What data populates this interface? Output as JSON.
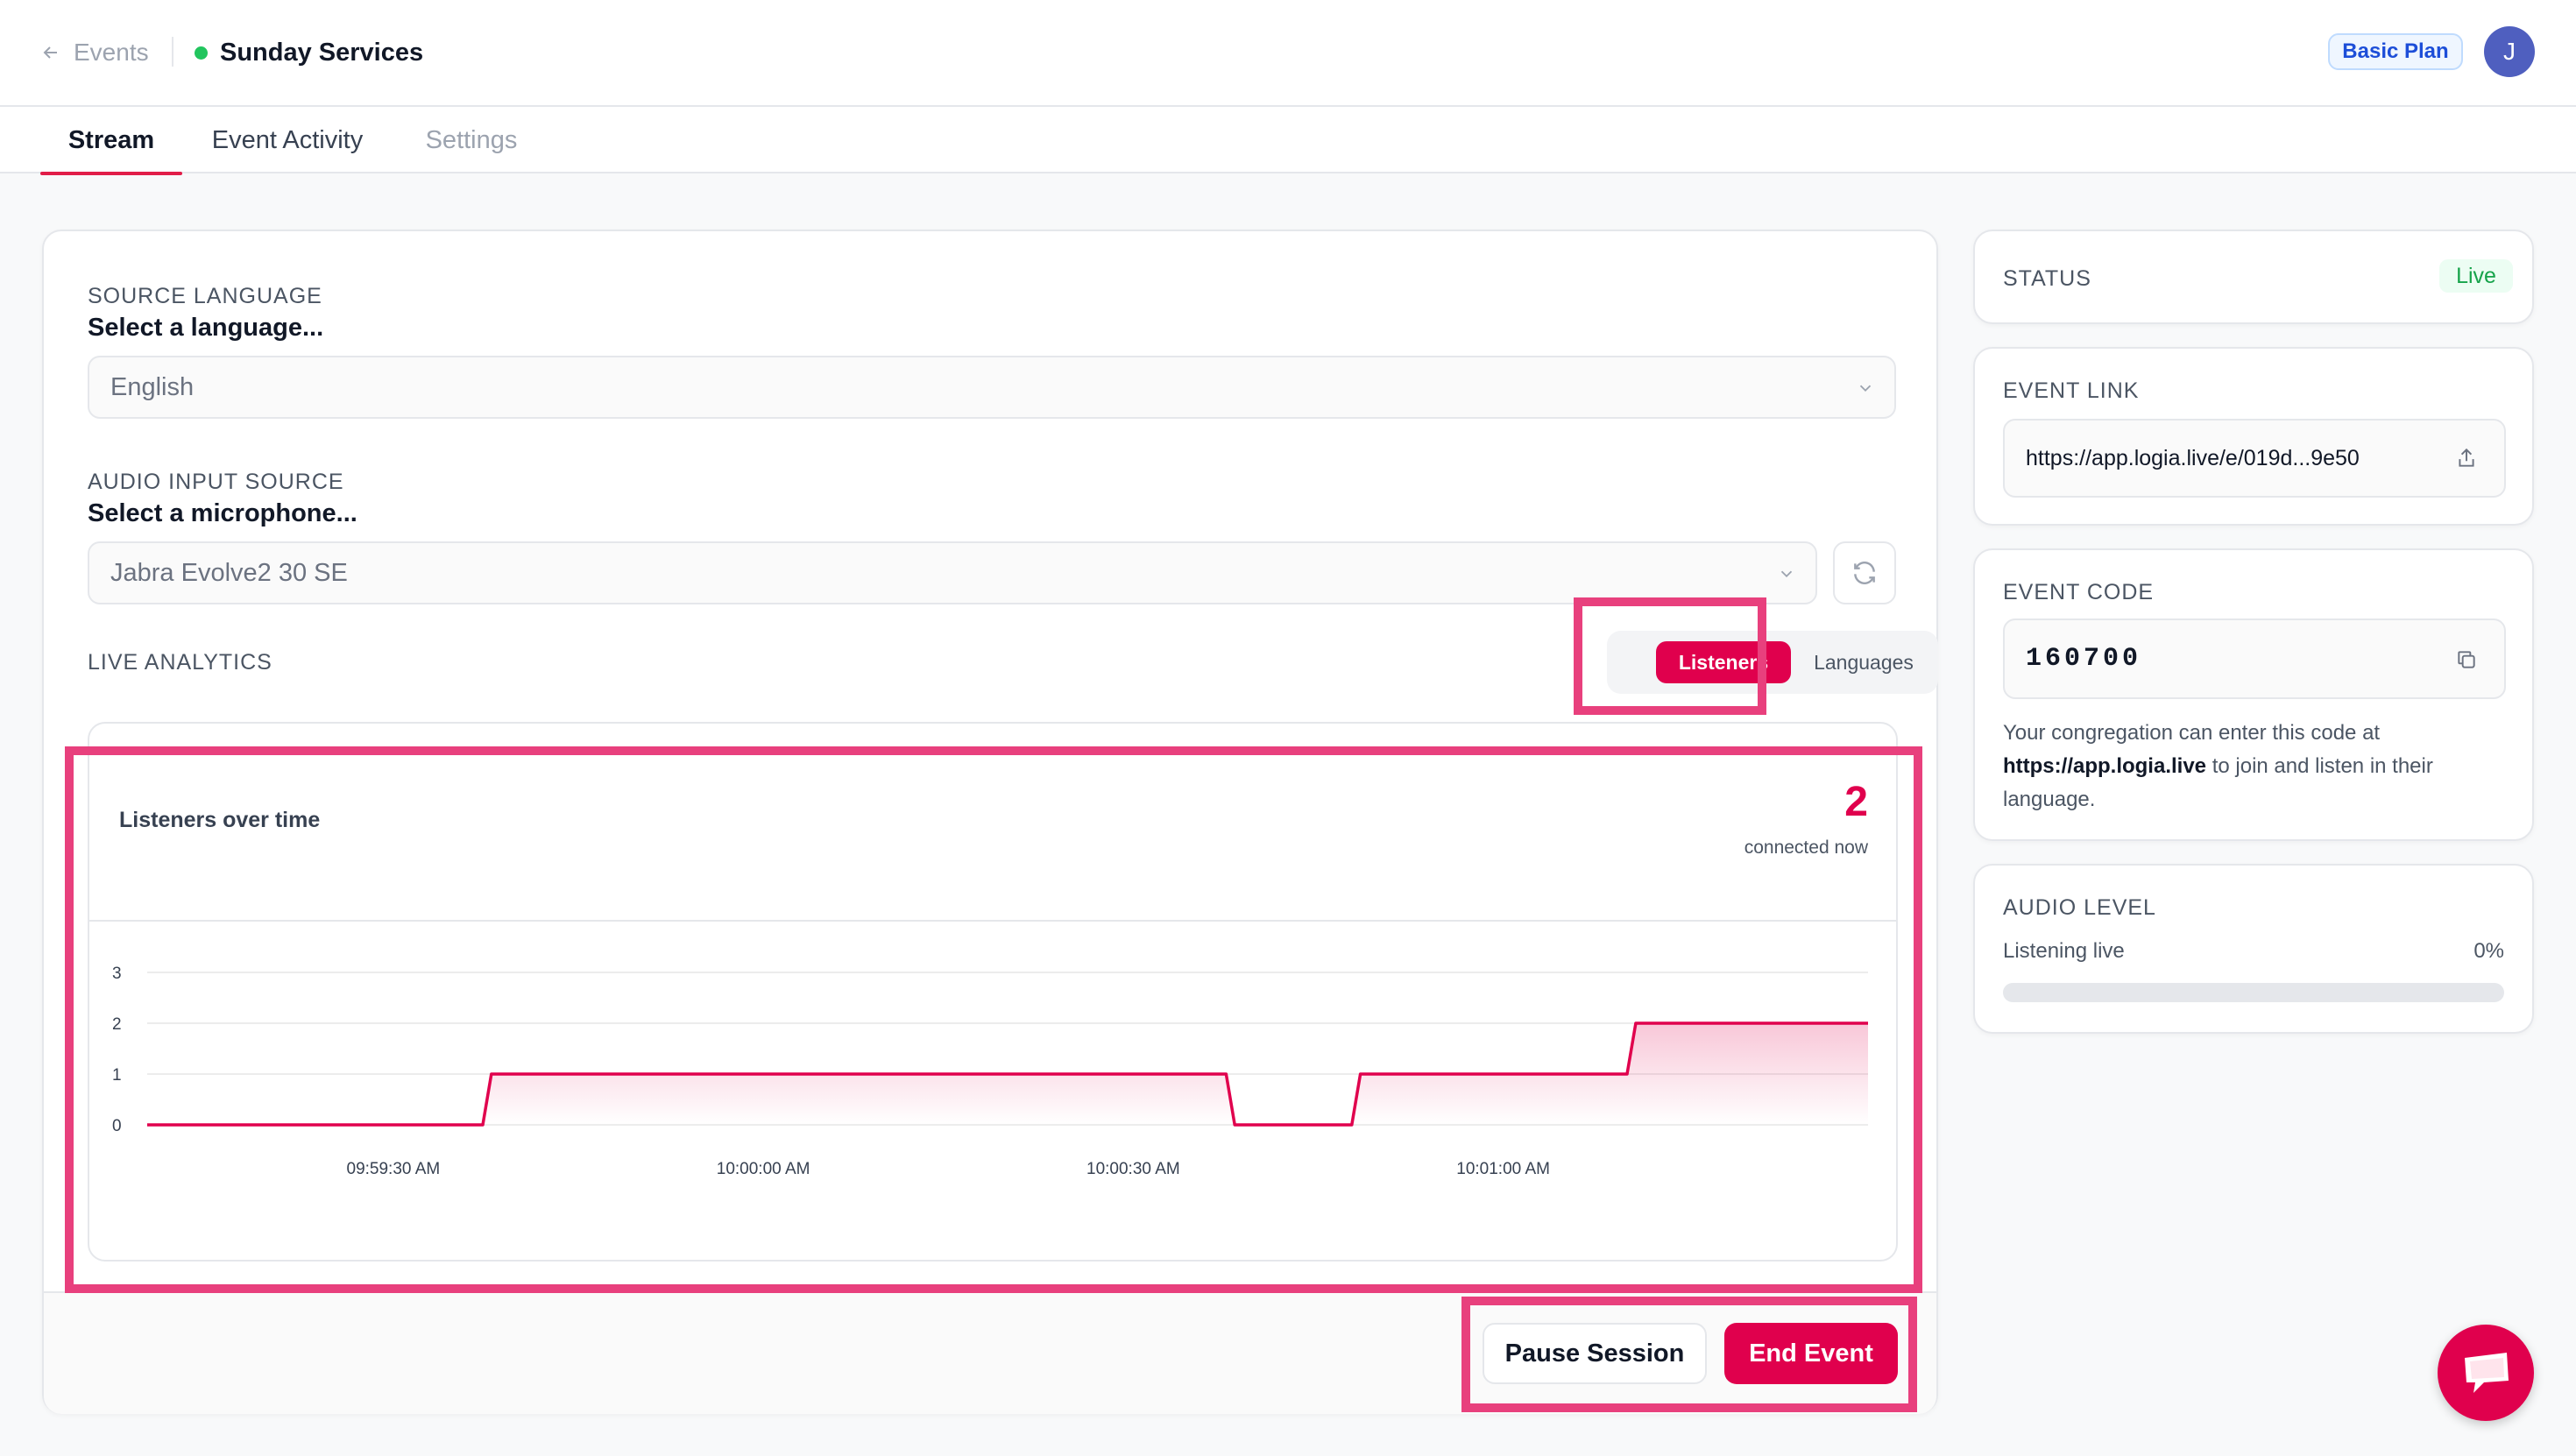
{
  "header": {
    "back_label": "Events",
    "event_title": "Sunday Services",
    "plan_badge": "Basic Plan",
    "avatar_initial": "J",
    "live_color": "#22c55e"
  },
  "tabs": [
    {
      "label": "Stream",
      "state": "active"
    },
    {
      "label": "Event Activity",
      "state": "normal"
    },
    {
      "label": "Settings",
      "state": "disabled"
    }
  ],
  "source_language": {
    "label": "SOURCE LANGUAGE",
    "hint": "Select a language...",
    "value": "English"
  },
  "audio_input": {
    "label": "AUDIO INPUT SOURCE",
    "hint": "Select a microphone...",
    "value": "Jabra Evolve2 30 SE"
  },
  "analytics": {
    "label": "LIVE ANALYTICS",
    "toggle_listeners": "Listeners",
    "toggle_languages": "Languages",
    "selected": "Listeners"
  },
  "listeners_card": {
    "title": "Listeners over time",
    "count": "2",
    "count_label": "connected now"
  },
  "chart_data": {
    "type": "area",
    "title": "Listeners over time",
    "xlabel": "",
    "ylabel": "",
    "ylim": [
      0,
      3
    ],
    "yticks": [
      "0",
      "1",
      "2",
      "3"
    ],
    "xticks": [
      "09:59:30 AM",
      "10:00:00 AM",
      "10:00:30 AM",
      "10:01:00 AM"
    ],
    "color": "#e0004d",
    "grid": true,
    "series": [
      {
        "x": [
          0,
          0.195,
          0.2,
          0.627,
          0.632,
          0.7,
          0.705,
          0.86,
          0.865,
          1.0
        ],
        "values": [
          0,
          0,
          1,
          1,
          0,
          0,
          1,
          1,
          2,
          2
        ]
      }
    ]
  },
  "actions": {
    "pause": "Pause Session",
    "end": "End Event"
  },
  "status": {
    "label": "STATUS",
    "value": "Live"
  },
  "event_link": {
    "label": "EVENT LINK",
    "url": "https://app.logia.live/e/019d...9e50"
  },
  "event_code": {
    "label": "EVENT CODE",
    "code": "160700",
    "hint_before": "Your congregation can enter this code at ",
    "hint_link": "https://app.logia.live",
    "hint_after": " to join and listen in their language."
  },
  "audio_level": {
    "label": "AUDIO LEVEL",
    "status": "Listening live",
    "percent_text": "0%",
    "level": 0
  },
  "icons": [
    "arrow-left-icon",
    "chevron-down-icon",
    "refresh-icon",
    "share-icon",
    "copy-icon",
    "chat-icon"
  ]
}
